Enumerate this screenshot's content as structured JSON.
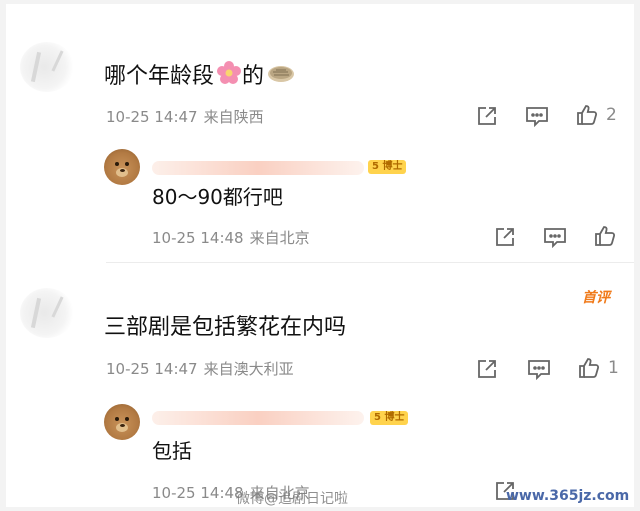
{
  "comments": [
    {
      "text": "哪个年龄段",
      "text_suffix": "的",
      "time": "10-25 14:47",
      "location": "来自陕西",
      "like_count": "2",
      "reply": {
        "badge": "5 博士",
        "text": "80～90都行吧",
        "time": "10-25 14:48",
        "location": "来自北京"
      }
    },
    {
      "tag": "首评",
      "text": "三部剧是包括繁花在内吗",
      "time": "10-25 14:47",
      "location": "来自澳大利亚",
      "like_count": "1",
      "reply": {
        "badge": "5 博士",
        "text": "包括",
        "time": "10-25 14:48",
        "location": "来自北京"
      }
    }
  ],
  "watermark": {
    "left": "微博@追剧日记啦",
    "right": "www.365jz.com"
  },
  "colors": {
    "accent_orange": "#f07a1a",
    "meta_gray": "#8a8a8a",
    "text": "#111111"
  }
}
